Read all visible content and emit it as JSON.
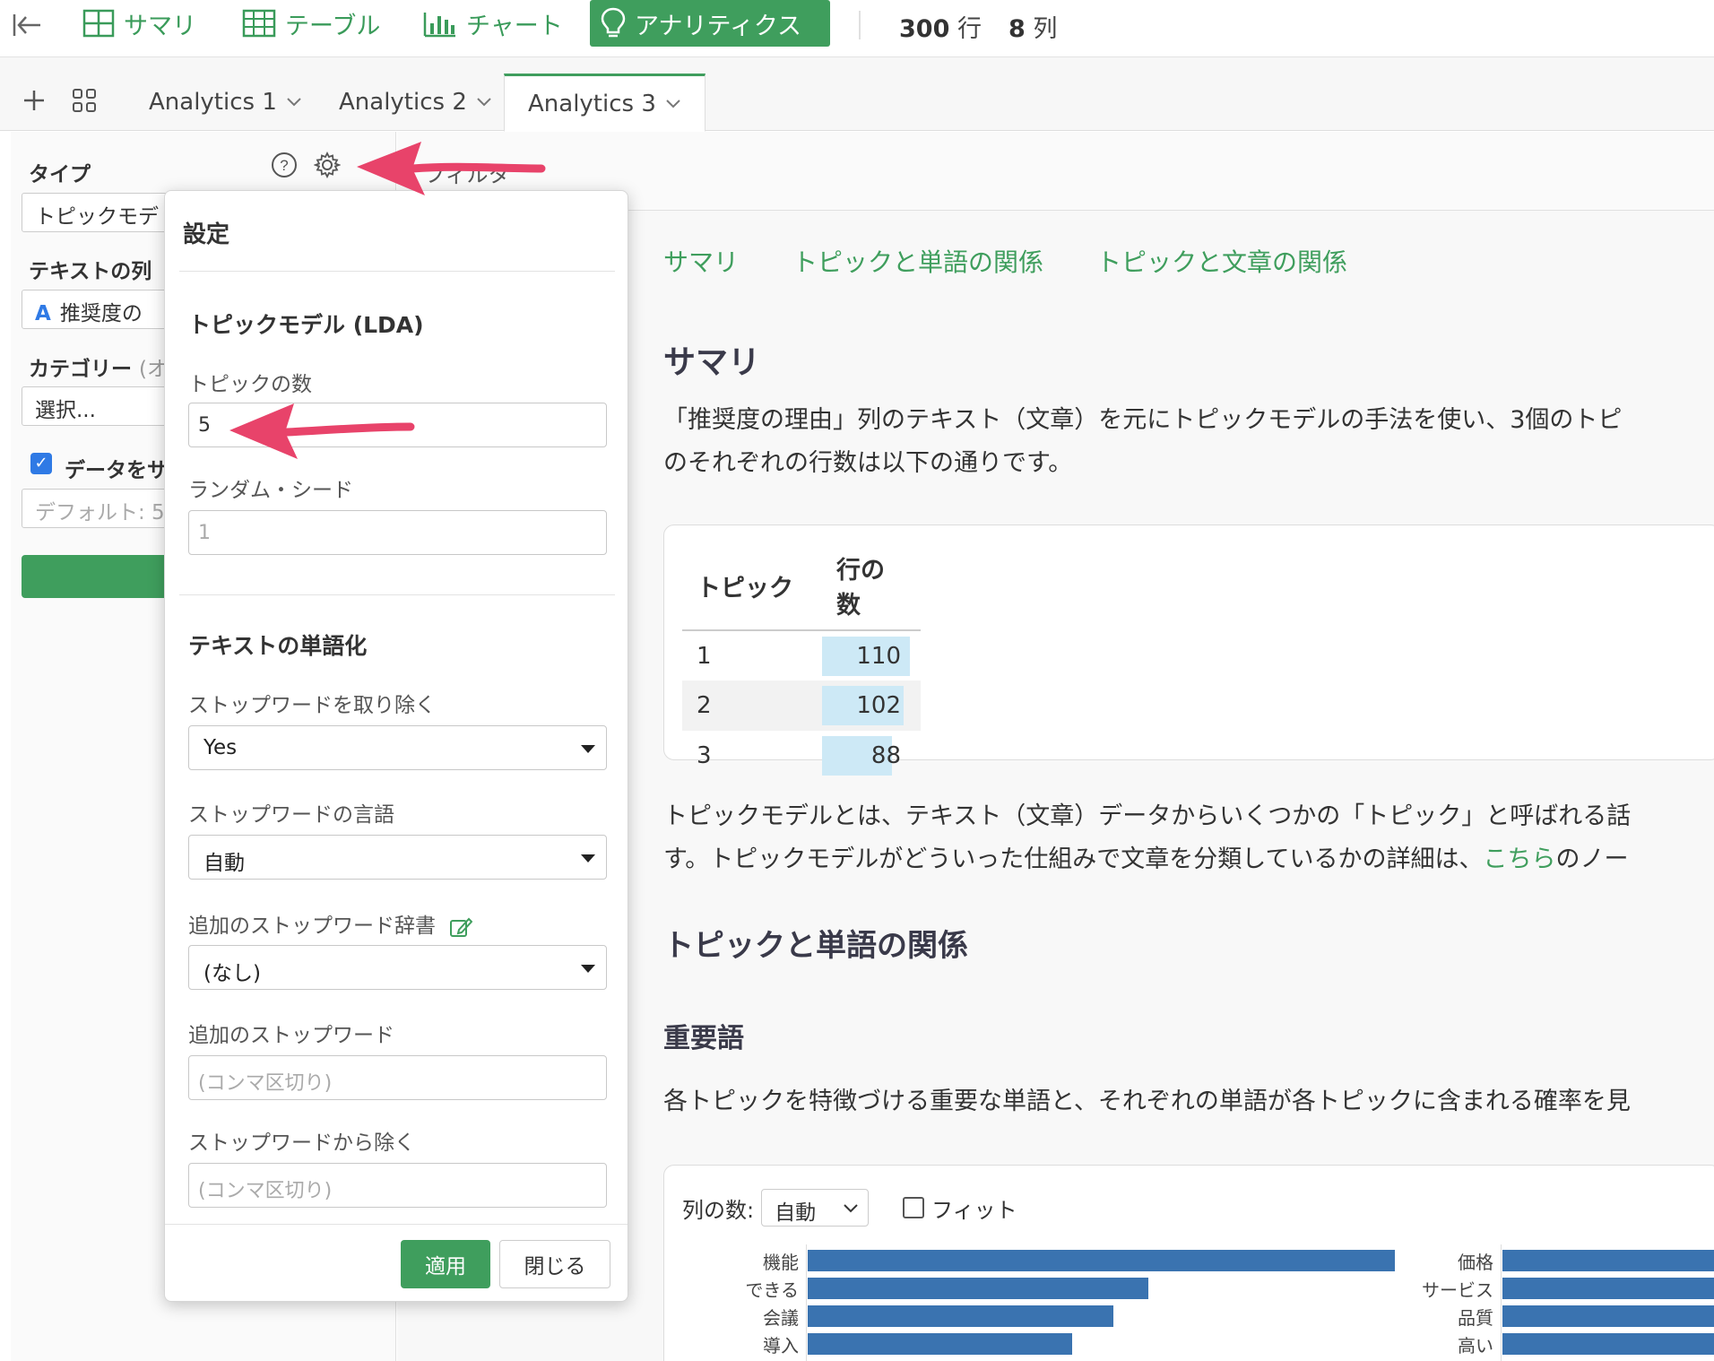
{
  "topbar": {
    "nav": [
      {
        "label": "サマリ",
        "icon": "grid-icon"
      },
      {
        "label": "テーブル",
        "icon": "table-icon"
      },
      {
        "label": "チャート",
        "icon": "bar-chart-icon"
      },
      {
        "label": "アナリティクス",
        "icon": "lightbulb-icon"
      }
    ],
    "rows_count": "300",
    "rows_unit": "行",
    "cols_count": "8",
    "cols_unit": "列"
  },
  "tabs": {
    "items": [
      {
        "label": "Analytics 1"
      },
      {
        "label": "Analytics 2"
      },
      {
        "label": "Analytics 3"
      }
    ],
    "active_index": 2
  },
  "left_panel": {
    "type_label": "タイプ",
    "type_value": "トピックモデ",
    "text_col_label": "テキストの列",
    "text_col_value": "推奨度の",
    "text_col_icon": "A",
    "category_label": "カテゴリー",
    "category_opt": "(オ",
    "category_value": "選択...",
    "sample_label": "データをサ",
    "sample_placeholder": "デフォルト: 5"
  },
  "main": {
    "filter_label": "フィルタ",
    "report_nav": [
      "サマリ",
      "トピックと単語の関係",
      "トピックと文章の関係"
    ],
    "summary_heading": "サマリ",
    "summary_para_1": "「推奨度の理由」列のテキスト（文章）を元にトピックモデルの手法を使い、3個のトピ",
    "summary_para_2": "のそれぞれの行数は以下の通りです。",
    "summary_table": {
      "headers": [
        "トピック",
        "行の数"
      ],
      "rows": [
        {
          "topic": "1",
          "count": "110",
          "value": 110
        },
        {
          "topic": "2",
          "count": "102",
          "value": 102
        },
        {
          "topic": "3",
          "count": "88",
          "value": 88
        }
      ]
    },
    "topic_para_1": "トピックモデルとは、テキスト（文章）データからいくつかの「トピック」と呼ばれる話",
    "topic_para_2a": "す。トピックモデルがどういった仕組みで文章を分類しているかの詳細は、",
    "topic_para_link": "こちら",
    "topic_para_2b": "のノー",
    "word_heading": "トピックと単語の関係",
    "important_heading": "重要語",
    "important_para": "各トピックを特徴づける重要な単語と、それぞれの単語が各トピックに含まれる確率を見",
    "chart_controls": {
      "cols_label": "列の数:",
      "cols_value": "自動",
      "fit_label": "フィット"
    }
  },
  "chart_data": [
    {
      "type": "bar",
      "orientation": "horizontal",
      "categories": [
        "機能",
        "できる",
        "会議",
        "導入"
      ],
      "values": [
        1.0,
        0.58,
        0.52,
        0.45
      ]
    },
    {
      "type": "bar",
      "orientation": "horizontal",
      "categories": [
        "価格",
        "サービス",
        "品質",
        "高い"
      ],
      "values": [
        null,
        null,
        null,
        null
      ]
    }
  ],
  "popup": {
    "title": "設定",
    "section_lda": "トピックモデル (LDA)",
    "num_topics_label": "トピックの数",
    "num_topics_value": "5",
    "seed_label": "ランダム・シード",
    "seed_placeholder": "1",
    "section_tokenize": "テキストの単語化",
    "remove_stopwords_label": "ストップワードを取り除く",
    "remove_stopwords_value": "Yes",
    "stopword_lang_label": "ストップワードの言語",
    "stopword_lang_value": "自動",
    "dict_label": "追加のストップワード辞書",
    "dict_value": "(なし)",
    "extra_stopwords_label": "追加のストップワード",
    "extra_stopwords_placeholder": "(コンマ区切り)",
    "exclude_label": "ストップワードから除く",
    "exclude_placeholder": "(コンマ区切り)",
    "apply_label": "適用",
    "close_label": "閉じる"
  },
  "colors": {
    "accent_green": "#3f9e5d",
    "annotation_arrow": "#e8436a",
    "bar_blue": "#3a73b0",
    "table_bar": "#cde9f6"
  }
}
